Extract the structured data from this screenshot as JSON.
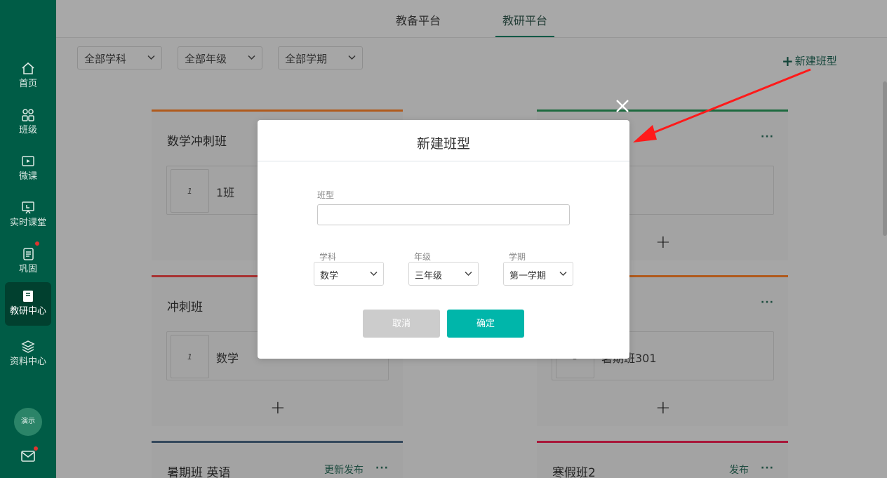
{
  "sidebar": {
    "items": [
      {
        "label": "首页",
        "icon": "home-icon"
      },
      {
        "label": "班级",
        "icon": "class-icon"
      },
      {
        "label": "微课",
        "icon": "micro-lesson-icon"
      },
      {
        "label": "实时课堂",
        "icon": "live-class-icon"
      },
      {
        "label": "巩固",
        "icon": "practice-icon"
      },
      {
        "label": "教研中心",
        "icon": "research-icon"
      },
      {
        "label": "资料中心",
        "icon": "layers-icon"
      }
    ],
    "avatar_text": "演示"
  },
  "top_tabs": [
    "教备平台",
    "教研平台"
  ],
  "filters": [
    "全部学科",
    "全部年级",
    "全部学期"
  ],
  "new_type_label": "新建班型",
  "cards": [
    {
      "title": "数学冲刺班",
      "item_index": "1",
      "item_name": "1班",
      "color": "#e06a1a"
    },
    {
      "title": "",
      "item_index": "",
      "item_name": "",
      "color": "#1f8a4c"
    },
    {
      "title": "冲刺班",
      "item_index": "1",
      "item_name": "数学",
      "color": "#d33a3a"
    },
    {
      "title": "",
      "item_index": "1",
      "item_name": "暑期班301",
      "color": "#e06a1a"
    },
    {
      "title": "暑期班 英语",
      "publish": "更新发布",
      "color": "#3c5a7a"
    },
    {
      "title": "寒假班2",
      "publish": "发布",
      "color": "#d61e4a"
    }
  ],
  "more_label": "···",
  "add_label": "+",
  "modal": {
    "title": "新建班型",
    "field_label": "班型",
    "field_value": "",
    "subject_label": "学科",
    "subject_value": "数学",
    "grade_label": "年级",
    "grade_value": "三年级",
    "term_label": "学期",
    "term_value": "第一学期",
    "cancel_label": "取消",
    "ok_label": "确定"
  },
  "colors": {
    "sidebar": "#005c46",
    "accent": "#00b6aa",
    "annotation_arrow": "#ff1a1a"
  }
}
